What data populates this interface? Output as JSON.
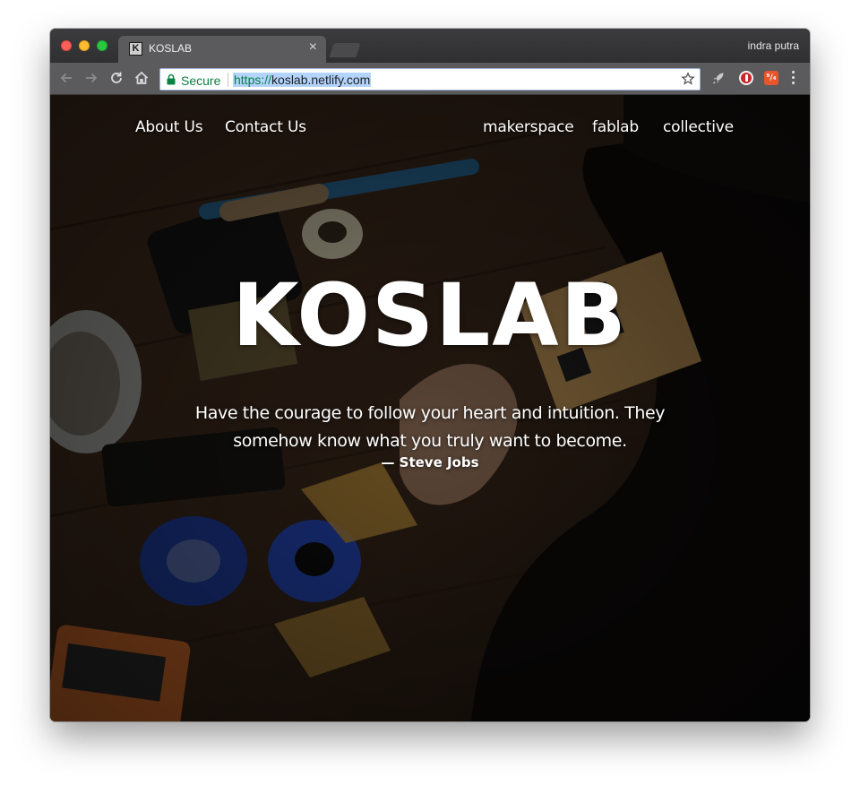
{
  "browser": {
    "tab": {
      "favicon_letter": "K",
      "title": "KOSLAB",
      "close_label": "×"
    },
    "profile_name": "indra putra",
    "omnibox": {
      "secure_label": "Secure",
      "url_scheme": "https://",
      "url_rest": "koslab.netlify.com"
    },
    "extensions": {
      "orange_label": "⁹/₄"
    },
    "icons": [
      "back-icon",
      "forward-icon",
      "reload-icon",
      "home-icon",
      "lock-icon",
      "star-icon",
      "rocket-icon",
      "ublock-icon",
      "menu-icon"
    ]
  },
  "page": {
    "nav": {
      "left": [
        "About Us",
        "Contact Us"
      ],
      "right": [
        "makerspace",
        "fablab",
        "collective"
      ]
    },
    "hero": {
      "title": "KOSLAB",
      "quote": "Have the courage to follow your heart and intuition. They somehow know what you truly want to become.",
      "author": "— Steve Jobs"
    }
  },
  "colors": {
    "secure_green": "#0b8043",
    "url_selection": "#b3d4fc",
    "hero_text": "#ffffff"
  }
}
